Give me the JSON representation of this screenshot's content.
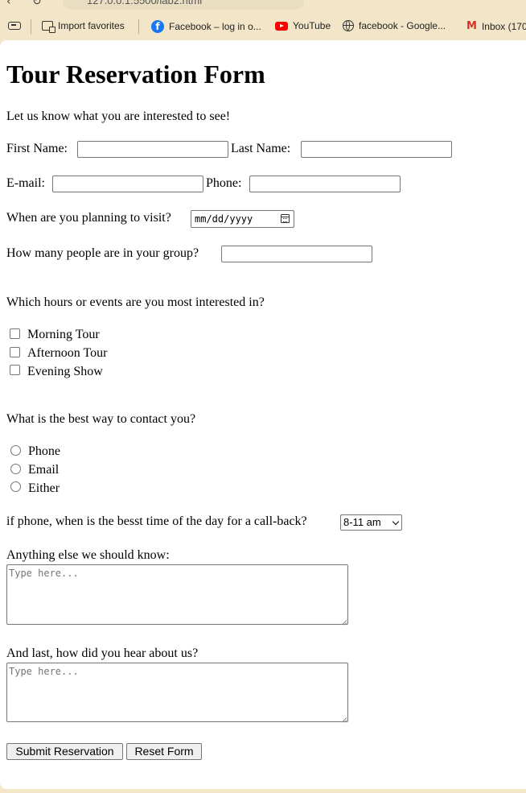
{
  "browser": {
    "url": "127.0.0.1:5500/lab2.html",
    "bookmarks": [
      {
        "label": "Import favorites",
        "icon": "import-favorites-icon"
      },
      {
        "label": "Facebook – log in o...",
        "icon": "facebook-icon"
      },
      {
        "label": "YouTube",
        "icon": "youtube-icon"
      },
      {
        "label": "facebook - Google...",
        "icon": "globe-icon"
      },
      {
        "label": "Inbox (170",
        "icon": "gmail-icon"
      }
    ]
  },
  "form": {
    "title": "Tour Reservation Form",
    "intro": "Let us know what you are interested to see!",
    "first_name_label": "First Name:",
    "last_name_label": "Last Name:",
    "email_label": "E-mail:",
    "phone_label": "Phone:",
    "visit_label": "When are you planning to visit?",
    "date_placeholder": "mm/dd/yyyy",
    "group_label": "How many people are in your group?",
    "events_question": "Which hours or events are you most interested in?",
    "events": [
      "Morning Tour",
      "Afternoon Tour",
      "Evening Show"
    ],
    "contact_question": "What is the best way to contact you?",
    "contact_options": [
      "Phone",
      "Email",
      "Either"
    ],
    "callback_label": "if phone, when is the besst time of the day for a call-back?",
    "callback_selected": "8-11 am",
    "anything_label": "Anything else we should know:",
    "anything_placeholder": "Type here...",
    "hear_label": "And last, how did you hear about us?",
    "hear_placeholder": "Type here...",
    "submit_label": "Submit Reservation",
    "reset_label": "Reset Form"
  }
}
